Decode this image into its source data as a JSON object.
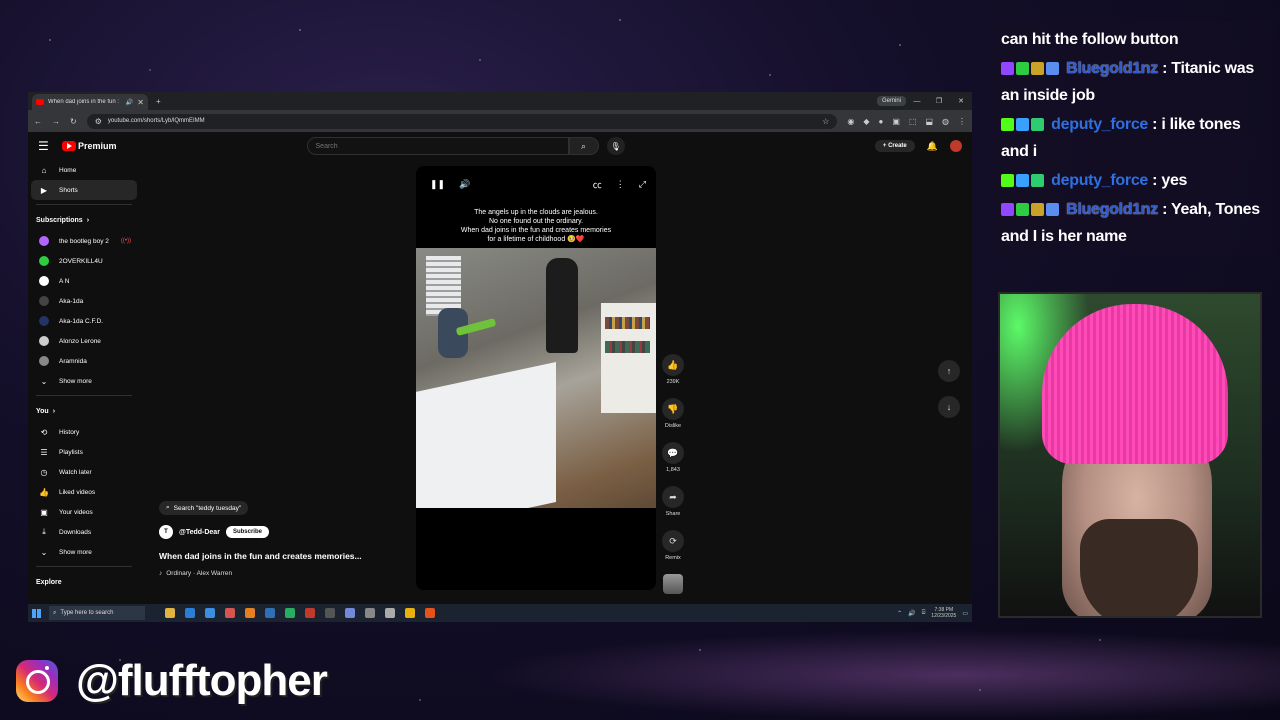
{
  "browser": {
    "tab_title": "When dad joins in the fun :",
    "gemini_label": "Gemini",
    "url": "youtube.com/shorts/Lyb/lQmmEIMM"
  },
  "youtube": {
    "brand": "Premium",
    "search_placeholder": "Search",
    "create_label": "Create",
    "sidebar": {
      "primary": [
        {
          "label": "Home",
          "icon": "home-icon"
        },
        {
          "label": "Shorts",
          "icon": "shorts-icon",
          "active": true
        }
      ],
      "subscriptions_heading": "Subscriptions",
      "subscriptions": [
        {
          "label": "the bootleg boy 2",
          "color": "#b266ff",
          "live": true
        },
        {
          "label": "2OVERKILL4U",
          "color": "#2ecc40"
        },
        {
          "label": "A N",
          "color": "#ffffff"
        },
        {
          "label": "Aka-1da",
          "color": "#444444"
        },
        {
          "label": "Aka-1da C.F.D.",
          "color": "#223366"
        },
        {
          "label": "Alonzo Lerone",
          "color": "#cccccc"
        },
        {
          "label": "Aramnida",
          "color": "#888888"
        }
      ],
      "show_more_1": "Show more",
      "you_heading": "You",
      "you_items": [
        {
          "label": "History",
          "icon": "history-icon"
        },
        {
          "label": "Playlists",
          "icon": "playlists-icon"
        },
        {
          "label": "Watch later",
          "icon": "watch-later-icon"
        },
        {
          "label": "Liked videos",
          "icon": "liked-videos-icon"
        },
        {
          "label": "Your videos",
          "icon": "your-videos-icon"
        },
        {
          "label": "Downloads",
          "icon": "downloads-icon"
        }
      ],
      "show_more_2": "Show more",
      "explore_heading": "Explore"
    },
    "short": {
      "caption_lines": [
        "The angels up in the clouds are jealous.",
        "No one found out the ordinary.",
        "When dad joins in the fun and creates memories",
        "for a lifetime of childhood 🥹❤️"
      ],
      "search_chip": "Search \"teddy tuesday\"",
      "channel": "@Tedd-Dear",
      "subscribe_label": "Subscribe",
      "title": "When dad joins in the fun and creates memories...",
      "music": "Ordinary · Alex Warren",
      "likes": "239K",
      "dislike_label": "Dislike",
      "comments": "1,843",
      "share_label": "Share",
      "remix_label": "Remix"
    }
  },
  "taskbar": {
    "search_placeholder": "Type here to search",
    "time": "7:38 PM",
    "date": "12/23/2025"
  },
  "chat": {
    "messages": [
      {
        "user": "",
        "text": "can hit the follow button"
      },
      {
        "user": "Bluegold1nz",
        "text": "Titanic was an inside job",
        "style": "purple"
      },
      {
        "user": "deputy_force",
        "text": "i like tones and i",
        "style": "blue"
      },
      {
        "user": "deputy_force",
        "text": "yes",
        "style": "blue"
      },
      {
        "user": "Bluegold1nz",
        "text": "Yeah, Tones and I is her name",
        "style": "purple"
      }
    ]
  },
  "overlay": {
    "instagram_handle": "@flufftopher"
  }
}
